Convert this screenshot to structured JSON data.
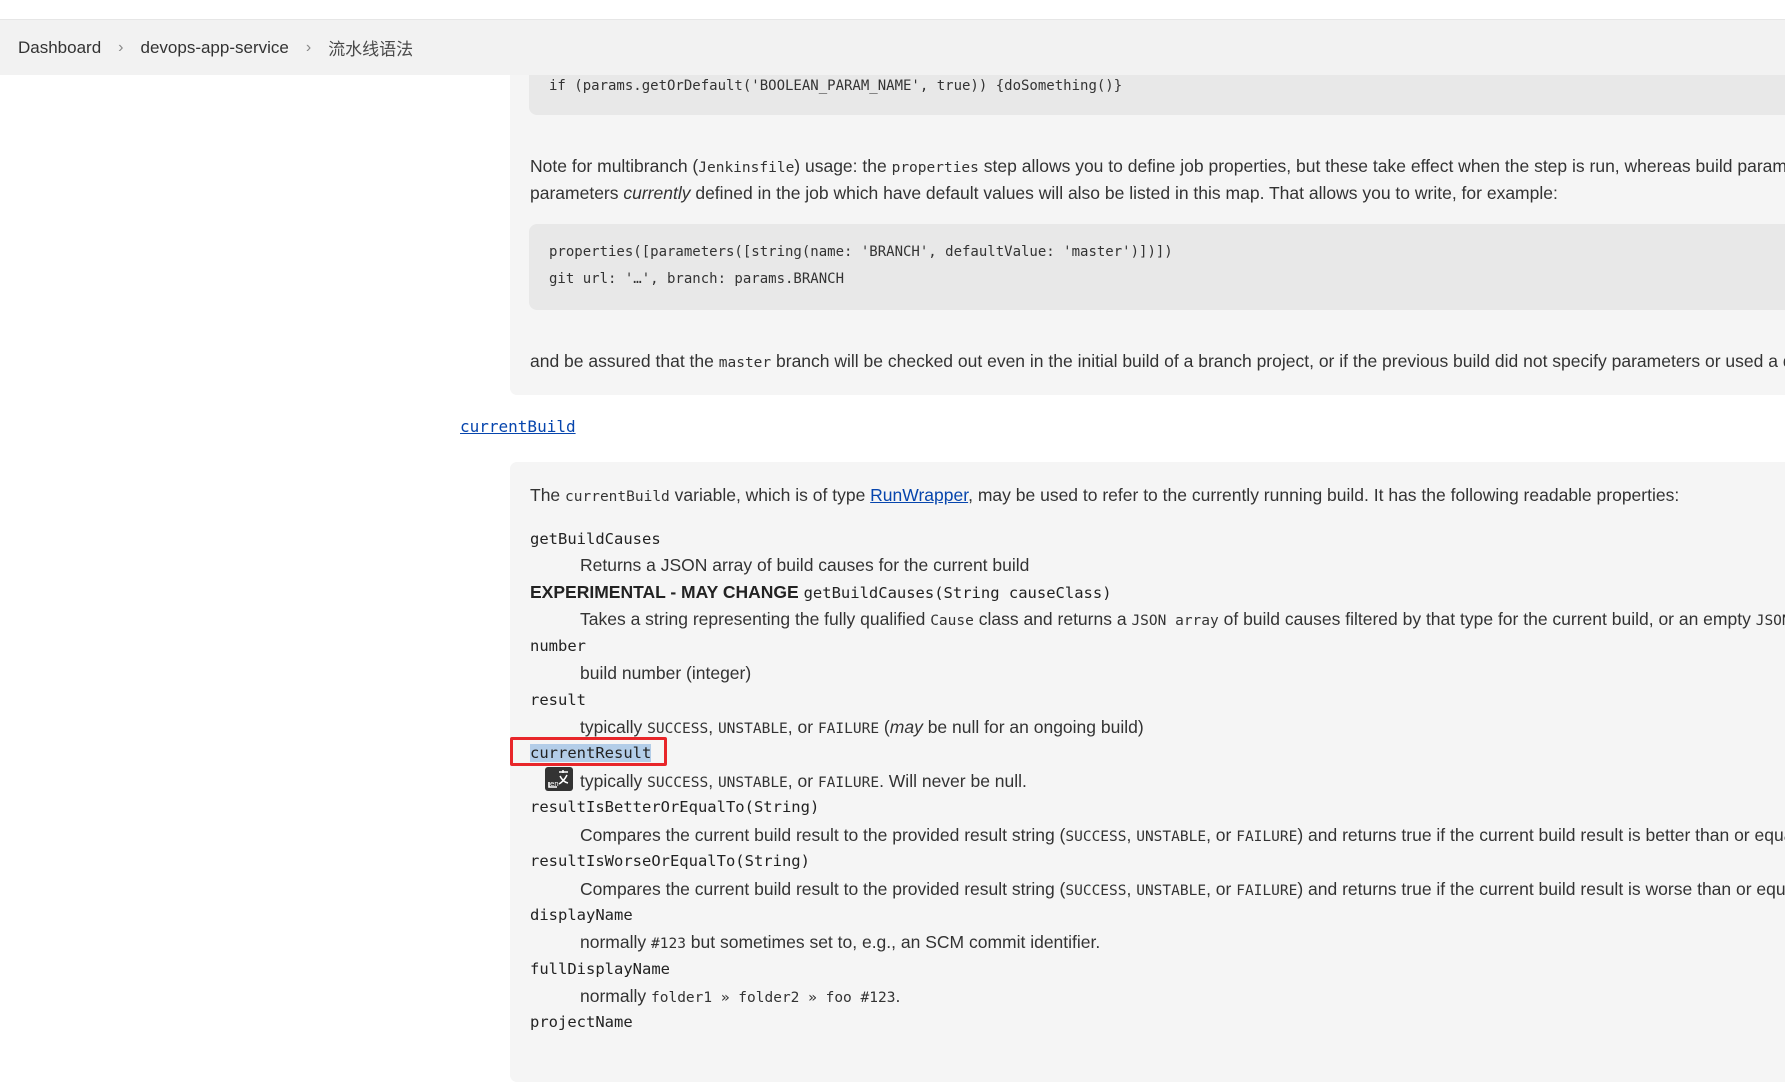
{
  "breadcrumb": [
    "Dashboard",
    "devops-app-service",
    "流水线语法"
  ],
  "colors": {
    "link": "#0645ad",
    "highlight": "#b3cde8",
    "annotation": "#e8262a"
  },
  "code1": "if (params.getOrDefault('BOOLEAN_PARAM_NAME', true)) {doSomething()}",
  "note": {
    "p1a": "Note for multibranch (",
    "p1code1": "Jenkinsfile",
    "p1b": ") usage: the ",
    "p1code2": "properties",
    "p1c": " step allows you to define job properties, but these take effect when the step is run, whereas build paramete",
    "p2a": "parameters ",
    "p2em": "currently",
    "p2b": " defined in the job which have default values will also be listed in this map. That allows you to write, for example:"
  },
  "code2": [
    "properties([parameters([string(name: 'BRANCH', defaultValue: 'master')])])",
    "git url: '…', branch: params.BRANCH"
  ],
  "assured": {
    "a": "and be assured that the ",
    "code": "master",
    "b": " branch will be checked out even in the initial build of a branch project, or if the previous build did not specify parameters or used a diffe"
  },
  "section_title": "currentBuild",
  "intro": {
    "a": "The ",
    "code": "currentBuild",
    "b": " variable, which is of type ",
    "link": "RunWrapper",
    "c": ", may be used to refer to the currently running build. It has the following readable properties:"
  },
  "properties": {
    "getBuildCauses": {
      "term": "getBuildCauses",
      "desc": "Returns a JSON array of build causes for the current build"
    },
    "experimental": {
      "label": "EXPERIMENTAL - MAY CHANGE",
      "term": "getBuildCauses(String causeClass)",
      "desc_a": "Takes a string representing the fully qualified ",
      "desc_code1": "Cause",
      "desc_b": " class and returns a ",
      "desc_code2": "JSON array",
      "desc_c": " of build causes filtered by that type for the current build, or an empty ",
      "desc_code3": "JSON ar"
    },
    "number": {
      "term": "number",
      "desc": "build number (integer)"
    },
    "result": {
      "term": "result",
      "desc_a": "typically ",
      "c1": "SUCCESS",
      "sep1": ", ",
      "c2": "UNSTABLE",
      "sep2": ", or ",
      "c3": "FAILURE",
      "desc_b": " (",
      "em": "may",
      "desc_c": " be null for an ongoing build)"
    },
    "currentResult": {
      "term": "currentResult",
      "desc_a": "typically ",
      "c1": "SUCCESS",
      "sep1": ", ",
      "c2": "UNSTABLE",
      "sep2": ", or ",
      "c3": "FAILURE",
      "desc_b": ". Will never be null."
    },
    "better": {
      "term": "resultIsBetterOrEqualTo(String)",
      "desc_a": "Compares the current build result to the provided result string (",
      "c1": "SUCCESS",
      "sep1": ", ",
      "c2": "UNSTABLE",
      "sep2": ", or ",
      "c3": "FAILURE",
      "desc_b": ") and returns true if the current build result is better than or equal t"
    },
    "worse": {
      "term": "resultIsWorseOrEqualTo(String)",
      "desc_a": "Compares the current build result to the provided result string (",
      "c1": "SUCCESS",
      "sep1": ", ",
      "c2": "UNSTABLE",
      "sep2": ", or ",
      "c3": "FAILURE",
      "desc_b": ") and returns true if the current build result is worse than or equal t"
    },
    "displayName": {
      "term": "displayName",
      "desc_a": "normally ",
      "c1": "#123",
      "desc_b": " but sometimes set to, e.g., an SCM commit identifier."
    },
    "fullDisplayName": {
      "term": "fullDisplayName",
      "desc_a": "normally ",
      "c1": "folder1 » folder2 » foo #123",
      "desc_b": "."
    },
    "projectName": {
      "term": "projectName"
    }
  },
  "icons": {
    "breadcrumb_separator": "chevron-right-icon",
    "translate": "translate-icon"
  }
}
